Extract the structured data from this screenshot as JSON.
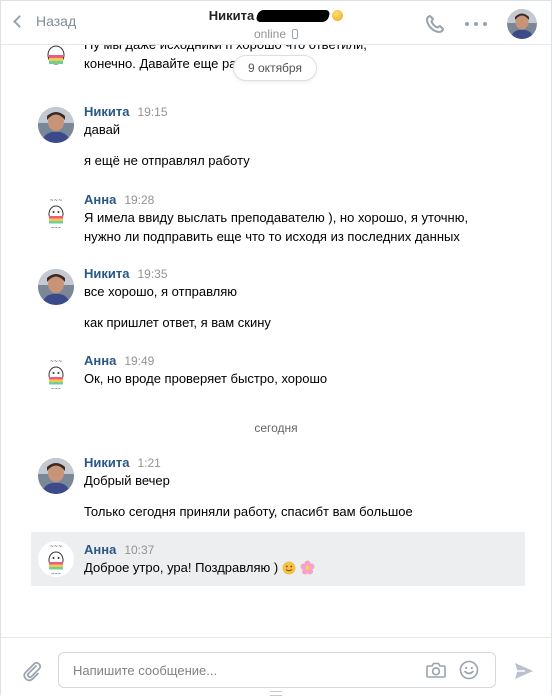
{
  "header": {
    "back_label": "Назад",
    "peer_name": "Никита",
    "peer_status": "online"
  },
  "date_pill": "9 октября",
  "day_separator": "сегодня",
  "messages": [
    {
      "author": "",
      "time": "",
      "avatar": "anna-sticker",
      "lines": [
        "Ну мы даже исходники п              хорошо что ответили,",
        "конечно. Давайте еще ра               ."
      ]
    },
    {
      "author": "Никита",
      "time": "19:15",
      "avatar": "nikita-photo",
      "lines": [
        "давай",
        "я ещё не отправлял работу"
      ]
    },
    {
      "author": "Анна",
      "time": "19:28",
      "avatar": "anna-sticker",
      "lines": [
        "Я имела ввиду выслать преподавателю ), но хорошо, я уточню,",
        "нужно ли подправить еще что то исходя из последних данных"
      ]
    },
    {
      "author": "Никита",
      "time": "19:35",
      "avatar": "nikita-photo",
      "lines": [
        "все хорошо, я отправляю",
        "как пришлет ответ, я вам скину"
      ]
    },
    {
      "author": "Анна",
      "time": "19:49",
      "avatar": "anna-sticker",
      "lines": [
        "Ок, но вроде проверяет быстро, хорошо"
      ]
    },
    {
      "author": "Никита",
      "time": "1:21",
      "avatar": "nikita-photo",
      "lines": [
        "Добрый вечер",
        "Только сегодня приняли работу, спасибт вам большое"
      ]
    },
    {
      "author": "Анна",
      "time": "10:37",
      "avatar": "anna-sticker",
      "lines": [
        "Доброе утро, ура! Поздравляю )"
      ],
      "emoji": [
        "smile-emoji",
        "flower-emoji"
      ]
    }
  ],
  "composer": {
    "placeholder": "Напишите сообщение..."
  },
  "colors": {
    "author": "#2a5885",
    "time": "#939393",
    "highlight": "#edeef0",
    "icon": "#99a2ad"
  }
}
